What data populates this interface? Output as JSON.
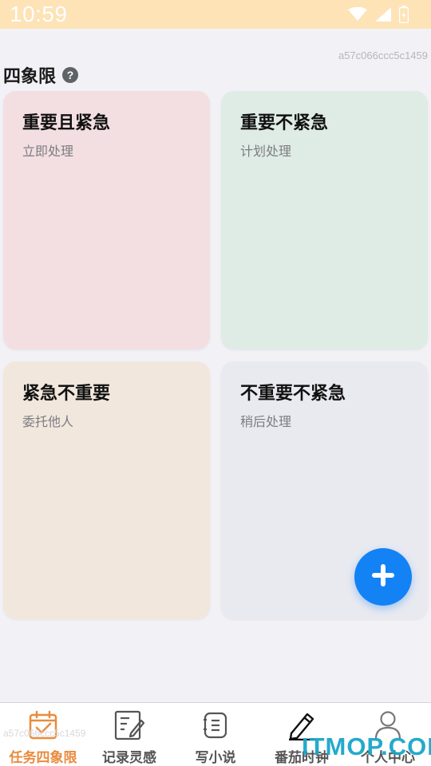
{
  "status_bar": {
    "time": "10:59"
  },
  "header": {
    "device_id": "a57c066ccc5c1459",
    "section_title": "四象限",
    "help_icon": "question-circle-icon"
  },
  "quadrants": [
    {
      "title": "重要且紧急",
      "subtitle": "立即处理",
      "color": "#f3dfe2"
    },
    {
      "title": "重要不紧急",
      "subtitle": "计划处理",
      "color": "#dfece6"
    },
    {
      "title": "紧急不重要",
      "subtitle": "委托他人",
      "color": "#f1e7dd"
    },
    {
      "title": "不重要不紧急",
      "subtitle": "稍后处理",
      "color": "#e9eaf0"
    }
  ],
  "fab": {
    "icon": "plus-icon",
    "color": "#1382f5"
  },
  "bottom_nav": {
    "active_color": "#e98b3d",
    "items": [
      {
        "label": "任务四象限",
        "icon": "calendar-check-icon",
        "active": true
      },
      {
        "label": "记录灵感",
        "icon": "notebook-pen-icon",
        "active": false
      },
      {
        "label": "写小说",
        "icon": "book-icon",
        "active": false
      },
      {
        "label": "番茄时钟",
        "icon": "pencil-icon",
        "active": false
      },
      {
        "label": "个人中心",
        "icon": "person-icon",
        "active": false
      }
    ]
  },
  "watermark": "ITMOP.COM"
}
